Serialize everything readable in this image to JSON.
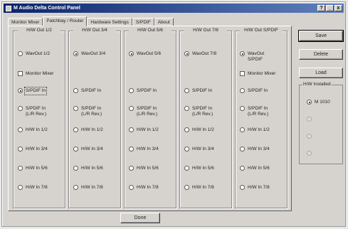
{
  "window": {
    "title": "M Audio Delta Control Panel",
    "title_icon": "app-icon"
  },
  "titlebar_buttons": {
    "help": "?",
    "minimize": "_",
    "close": "x"
  },
  "tabs": [
    {
      "label": "Monitor Mixer",
      "active": false
    },
    {
      "label": "Patchbay / Router",
      "active": true
    },
    {
      "label": "Hardware Settings",
      "active": false
    },
    {
      "label": "S/PDIF",
      "active": false
    },
    {
      "label": "About",
      "active": false
    }
  ],
  "columns": [
    {
      "title": "H/W Out 1/2",
      "options": [
        {
          "label": "WavOut 1/2",
          "type": "radio",
          "selected": false
        },
        {
          "label": "Monitor Mixer",
          "type": "check",
          "selected": false
        },
        {
          "label": "S/PDIF In",
          "type": "radio",
          "selected": true,
          "focused": true
        },
        {
          "label": "S/PDIF In",
          "label2": "(L/R Rev.)",
          "type": "radio",
          "selected": false
        },
        {
          "label": "H/W In 1/2",
          "type": "radio",
          "selected": false
        },
        {
          "label": "H/W In 3/4",
          "type": "radio",
          "selected": false
        },
        {
          "label": "H/W In 5/6",
          "type": "radio",
          "selected": false
        },
        {
          "label": "H/W In 7/8",
          "type": "radio",
          "selected": false
        }
      ]
    },
    {
      "title": "H/W Out 3/4",
      "options": [
        {
          "label": "WavOut 3/4",
          "type": "radio",
          "selected": true
        },
        null,
        {
          "label": "S/PDIF In",
          "type": "radio",
          "selected": false
        },
        {
          "label": "S/PDIF In",
          "label2": "(L/R Rev.)",
          "type": "radio",
          "selected": false
        },
        {
          "label": "H/W In 1/2",
          "type": "radio",
          "selected": false
        },
        {
          "label": "H/W In 3/4",
          "type": "radio",
          "selected": false
        },
        {
          "label": "H/W In 5/6",
          "type": "radio",
          "selected": false
        },
        {
          "label": "H/W In 7/8",
          "type": "radio",
          "selected": false
        }
      ]
    },
    {
      "title": "H/W Out 5/6",
      "options": [
        {
          "label": "WavOut 5/6",
          "type": "radio",
          "selected": true
        },
        null,
        {
          "label": "S/PDIF In",
          "type": "radio",
          "selected": false
        },
        {
          "label": "S/PDIF In",
          "label2": "(L/R Rev.)",
          "type": "radio",
          "selected": false
        },
        {
          "label": "H/W In 1/2",
          "type": "radio",
          "selected": false
        },
        {
          "label": "H/W In 3/4",
          "type": "radio",
          "selected": false
        },
        {
          "label": "H/W In 5/6",
          "type": "radio",
          "selected": false
        },
        {
          "label": "H/W In 7/8",
          "type": "radio",
          "selected": false
        }
      ]
    },
    {
      "title": "H/W Out 7/8",
      "options": [
        {
          "label": "WavOut 7/8",
          "type": "radio",
          "selected": true
        },
        null,
        {
          "label": "S/PDIF In",
          "type": "radio",
          "selected": false
        },
        {
          "label": "S/PDIF In",
          "label2": "(L/R Rev.)",
          "type": "radio",
          "selected": false
        },
        {
          "label": "H/W In 1/2",
          "type": "radio",
          "selected": false
        },
        {
          "label": "H/W In 3/4",
          "type": "radio",
          "selected": false
        },
        {
          "label": "H/W In 5/6",
          "type": "radio",
          "selected": false
        },
        {
          "label": "H/W In 7/8",
          "type": "radio",
          "selected": false
        }
      ]
    },
    {
      "title": "H/W Out S/PDIF",
      "options": [
        {
          "label": "WavOut",
          "label2": "S/PDIF",
          "type": "radio",
          "selected": true
        },
        {
          "label": "Monitor Mixer",
          "type": "check",
          "selected": false
        },
        {
          "label": "S/PDIF In",
          "type": "radio",
          "selected": false
        },
        {
          "label": "S/PDIF In",
          "label2": "(L/R Rev.)",
          "type": "radio",
          "selected": false
        },
        {
          "label": "H/W In 1/2",
          "type": "radio",
          "selected": false
        },
        {
          "label": "H/W In 3/4",
          "type": "radio",
          "selected": false
        },
        {
          "label": "H/W In 5/6",
          "type": "radio",
          "selected": false
        },
        {
          "label": "H/W In 7/8",
          "type": "radio",
          "selected": false
        }
      ]
    }
  ],
  "side_buttons": {
    "save": "Save",
    "delete": "Delete",
    "load": "Load"
  },
  "installed": {
    "title": "H/W Installed",
    "items": [
      {
        "label": "M 1010",
        "selected": true,
        "enabled": true
      },
      {
        "label": "",
        "selected": false,
        "enabled": false
      },
      {
        "label": "",
        "selected": false,
        "enabled": false
      },
      {
        "label": "",
        "selected": false,
        "enabled": false
      }
    ]
  },
  "footer": {
    "done": "Done"
  }
}
